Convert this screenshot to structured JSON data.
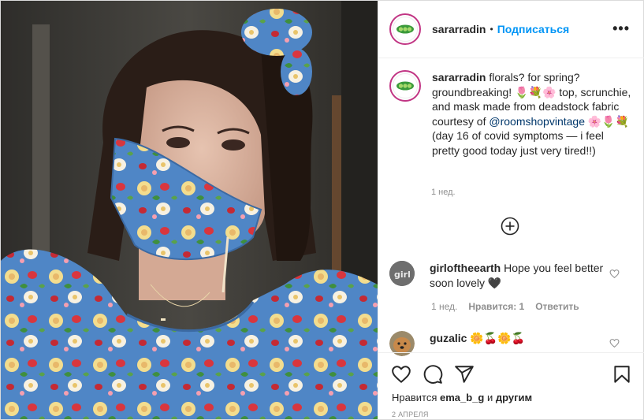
{
  "header": {
    "username": "sararradin",
    "separator": "•",
    "follow_label": "Подписаться",
    "more_label": "•••"
  },
  "caption": {
    "username": "sararradin",
    "text_1": "florals? for spring? groundbreaking! 🌷💐🌸 top, scrunchie, and mask made from deadstock fabric courtesy of ",
    "mention": "@roomshopvintage",
    "text_2": " 🌸🌷💐 (day 16 of covid symptoms — i feel pretty good today just very tired!!)",
    "time": "1 нед."
  },
  "comments": [
    {
      "username": "girloftheearth",
      "text": "Hope you feel better soon lovely 🖤",
      "time": "1 нед.",
      "likes": "Нравится: 1",
      "reply": "Ответить"
    },
    {
      "username": "guzalic",
      "text": "🌼🍒🌼🍒",
      "time": "",
      "likes": "",
      "reply": ""
    }
  ],
  "footer": {
    "likes_prefix": "Нравится",
    "likes_user": "ema_b_g",
    "likes_suffix": "и",
    "likes_others": "другим",
    "date": "2 АПРЕЛЯ"
  },
  "icons": {
    "like": "heart-icon",
    "comment": "comment-icon",
    "share": "share-icon",
    "save": "bookmark-icon",
    "more_comments": "plus-circle-icon"
  },
  "colors": {
    "accent": "#0095f6",
    "mention": "#00376b",
    "muted": "#8e8e8e",
    "ring": "#c13584"
  }
}
